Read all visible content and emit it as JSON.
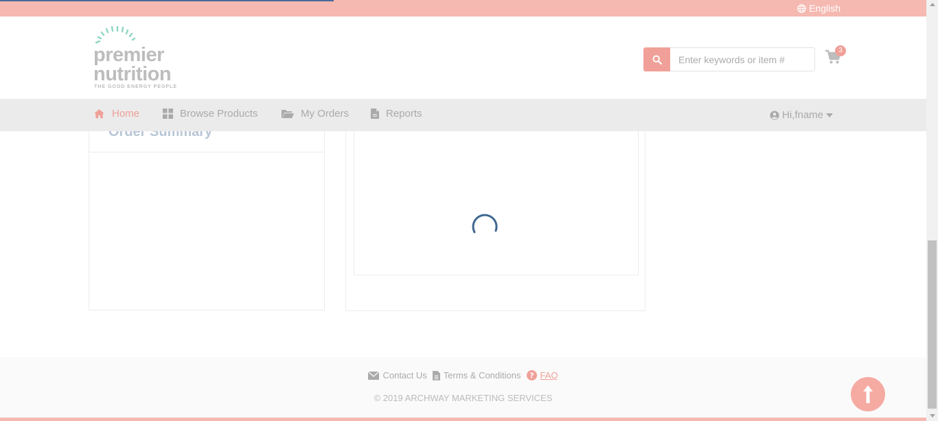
{
  "topbar": {
    "language_label": "English",
    "accent_color": "#f5b9b1"
  },
  "brand": {
    "line1": "premier",
    "line2": "nutrition",
    "tagline": "THE GOOD ENERGY PEOPLE"
  },
  "search": {
    "placeholder": "Enter keywords or item #",
    "icon": "search-icon"
  },
  "cart": {
    "count": "3",
    "icon": "cart-icon"
  },
  "nav": {
    "items": [
      {
        "label": "Home",
        "icon": "home-icon",
        "active": true
      },
      {
        "label": "Browse Products",
        "icon": "grid-icon",
        "active": false
      },
      {
        "label": "My Orders",
        "icon": "folder-icon",
        "active": false
      },
      {
        "label": "Reports",
        "icon": "file-icon",
        "active": false
      }
    ],
    "user_greeting": "Hi,fname"
  },
  "main": {
    "order_summary_title": "Order Summary"
  },
  "footer": {
    "contact_label": "Contact Us",
    "terms_label": "Terms & Conditions",
    "faq_label": "FAQ",
    "copyright": "© 2019 ARCHWAY MARKETING SERVICES"
  }
}
